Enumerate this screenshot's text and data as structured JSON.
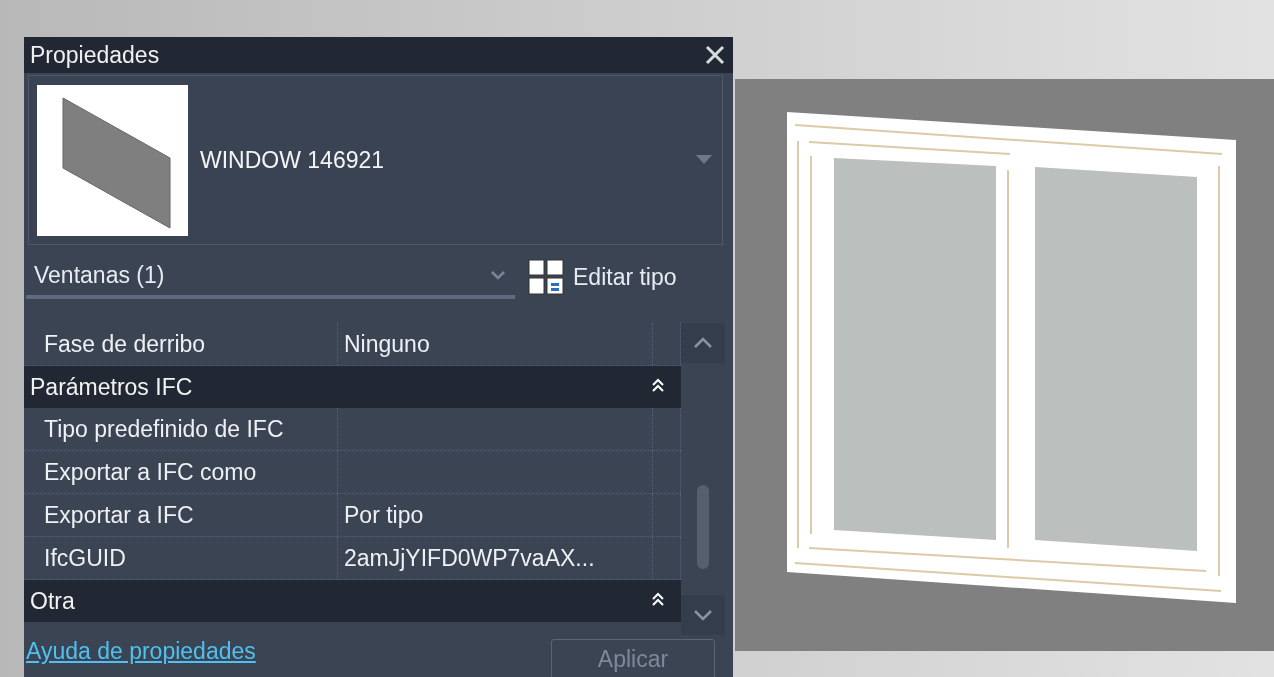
{
  "panel": {
    "title": "Propiedades"
  },
  "type_selector": {
    "name": "WINDOW 146921"
  },
  "category_filter": {
    "value": "Ventanas (1)"
  },
  "edit_type_button": {
    "label": "Editar tipo"
  },
  "properties": [
    {
      "kind": "row",
      "label": "Fase de derribo",
      "value": "Ninguno"
    },
    {
      "kind": "group",
      "title": "Parámetros IFC",
      "expanded": true,
      "rows": [
        {
          "label": "Tipo predefinido de IFC",
          "value": ""
        },
        {
          "label": "Exportar a IFC como",
          "value": ""
        },
        {
          "label": "Exportar a IFC",
          "value": "Por tipo"
        },
        {
          "label": "IfcGUID",
          "value": "2amJjYIFD0WP7vaAX..."
        }
      ]
    },
    {
      "kind": "group",
      "title": "Otra",
      "expanded": true
    }
  ],
  "help_link": "Ayuda de propiedades",
  "apply_button": {
    "label": "Aplicar",
    "disabled": true
  }
}
